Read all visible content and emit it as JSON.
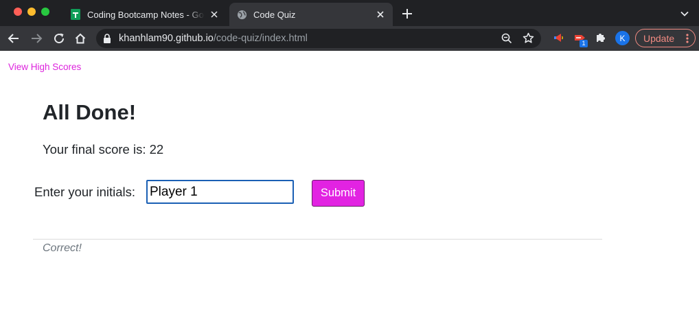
{
  "browser": {
    "tabs": [
      {
        "title": "Coding Bootcamp Notes - Goo",
        "active": false,
        "favicon": "google-sheets-icon"
      },
      {
        "title": "Code Quiz",
        "active": true,
        "favicon": "globe-icon"
      }
    ],
    "url": {
      "host": "khanhlam90.github.io",
      "path": "/code-quiz/index.html"
    },
    "extension_badge": "1",
    "profile_initial": "K",
    "update_label": "Update"
  },
  "page": {
    "high_scores_link": "View High Scores",
    "heading": "All Done!",
    "score_text": "Your final score is: 22",
    "initials_label": "Enter your initials:",
    "initials_value": "Player 1",
    "submit_label": "Submit",
    "feedback": "Correct!"
  },
  "colors": {
    "accent": "#e223e2",
    "link": "#dd22dd",
    "chrome_dark": "#202124",
    "chrome_toolbar": "#35363a"
  }
}
